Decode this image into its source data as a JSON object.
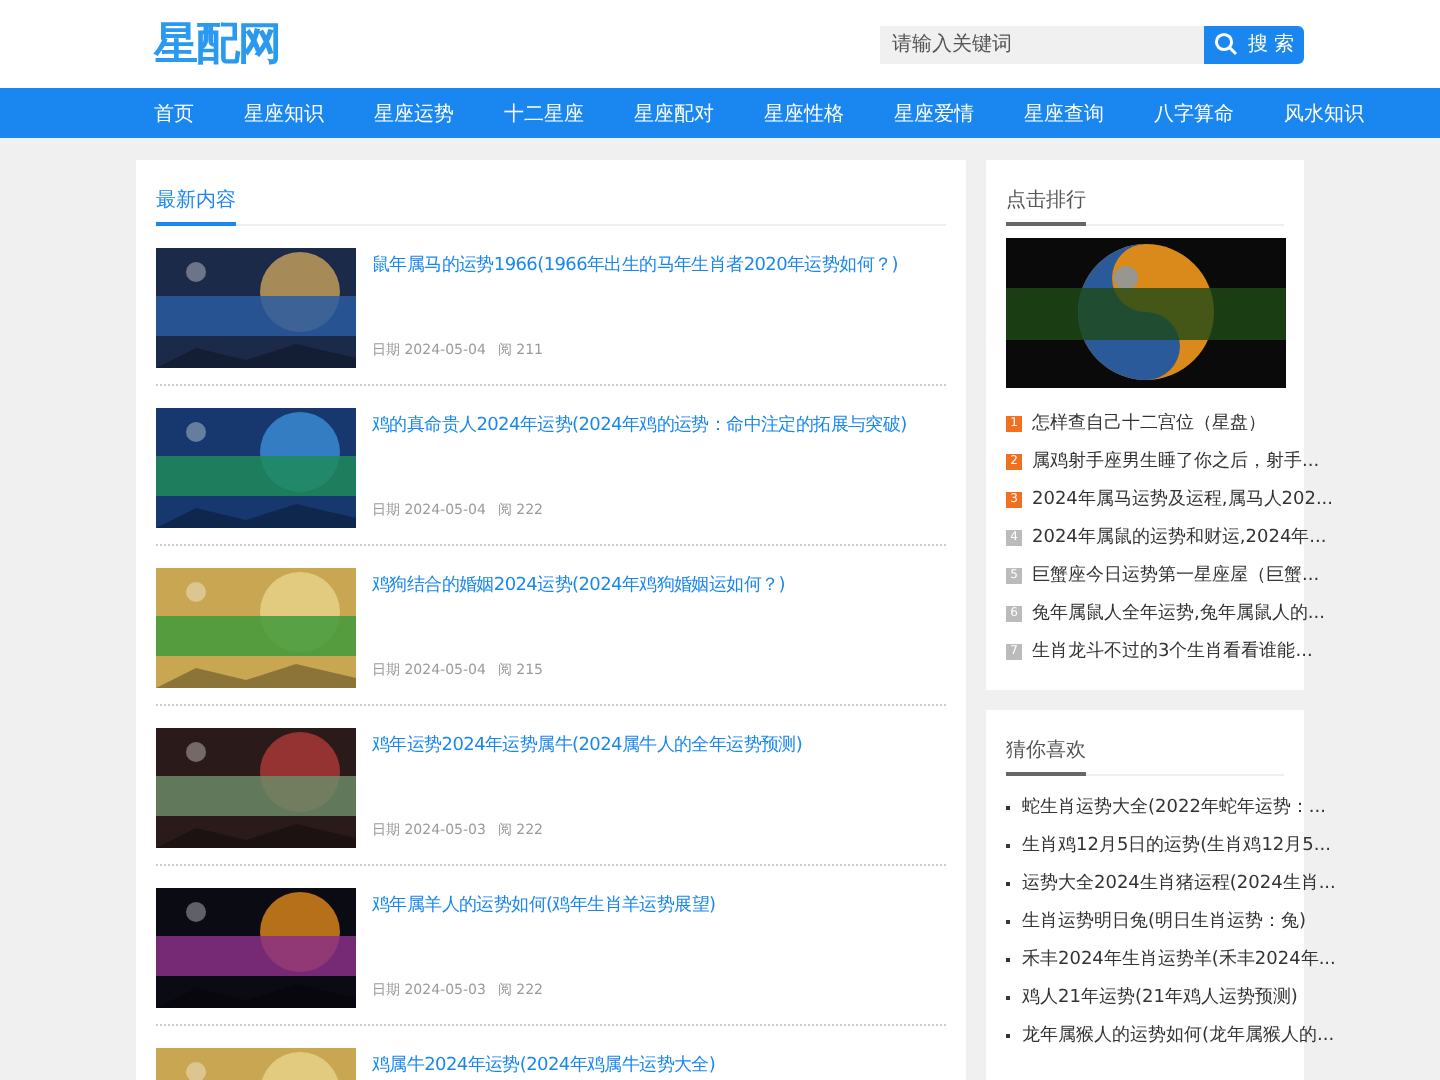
{
  "logo": "星配网",
  "search": {
    "placeholder": "请输入关键词",
    "button": "搜 索"
  },
  "nav": [
    "首页",
    "星座知识",
    "星座运势",
    "十二星座",
    "星座配对",
    "星座性格",
    "星座爱情",
    "星座查询",
    "八字算命",
    "风水知识"
  ],
  "latest": {
    "title": "最新内容",
    "articles": [
      {
        "title": "鼠年属马的运势1966(1966年出生的马年生肖者2020年运势如何？)",
        "date": "日期 2024-05-04",
        "views": "阅 211"
      },
      {
        "title": "鸡的真命贵人2024年运势(2024年鸡的运势：命中注定的拓展与突破)",
        "date": "日期 2024-05-04",
        "views": "阅 222"
      },
      {
        "title": "鸡狗结合的婚姻2024运势(2024年鸡狗婚姻运如何？)",
        "date": "日期 2024-05-04",
        "views": "阅 215"
      },
      {
        "title": "鸡年运势2024年运势属牛(2024属牛人的全年运势预测)",
        "date": "日期 2024-05-03",
        "views": "阅 222"
      },
      {
        "title": "鸡年属羊人的运势如何(鸡年生肖羊运势展望)",
        "date": "日期 2024-05-03",
        "views": "阅 222"
      },
      {
        "title": "鸡属牛2024年运势(2024年鸡属牛运势大全)"
      }
    ]
  },
  "ranking": {
    "title": "点击排行",
    "items": [
      {
        "rank": "1",
        "hot": true,
        "text": "怎样查自己十二宫位（星盘）"
      },
      {
        "rank": "2",
        "hot": true,
        "text": "属鸡射手座男生睡了你之后，射手..."
      },
      {
        "rank": "3",
        "hot": true,
        "text": "2024年属马运势及运程,属马人202..."
      },
      {
        "rank": "4",
        "hot": false,
        "text": "2024年属鼠的运势和财运,2024年..."
      },
      {
        "rank": "5",
        "hot": false,
        "text": "巨蟹座今日运势第一星座屋（巨蟹..."
      },
      {
        "rank": "6",
        "hot": false,
        "text": "兔年属鼠人全年运势,兔年属鼠人的..."
      },
      {
        "rank": "7",
        "hot": false,
        "text": "生肖龙斗不过的3个生肖看看谁能..."
      }
    ]
  },
  "guess": {
    "title": "猜你喜欢",
    "items": [
      "蛇生肖运势大全(2022年蛇年运势：...",
      "生肖鸡12月5日的运势(生肖鸡12月5...",
      "运势大全2024生肖猪运程(2024生肖...",
      "生肖运势明日兔(明日生肖运势：兔)",
      "禾丰2024年生肖运势羊(禾丰2024年...",
      "鸡人21年运势(21年鸡人运势预测)",
      "龙年属猴人的运势如何(龙年属猴人的..."
    ]
  }
}
